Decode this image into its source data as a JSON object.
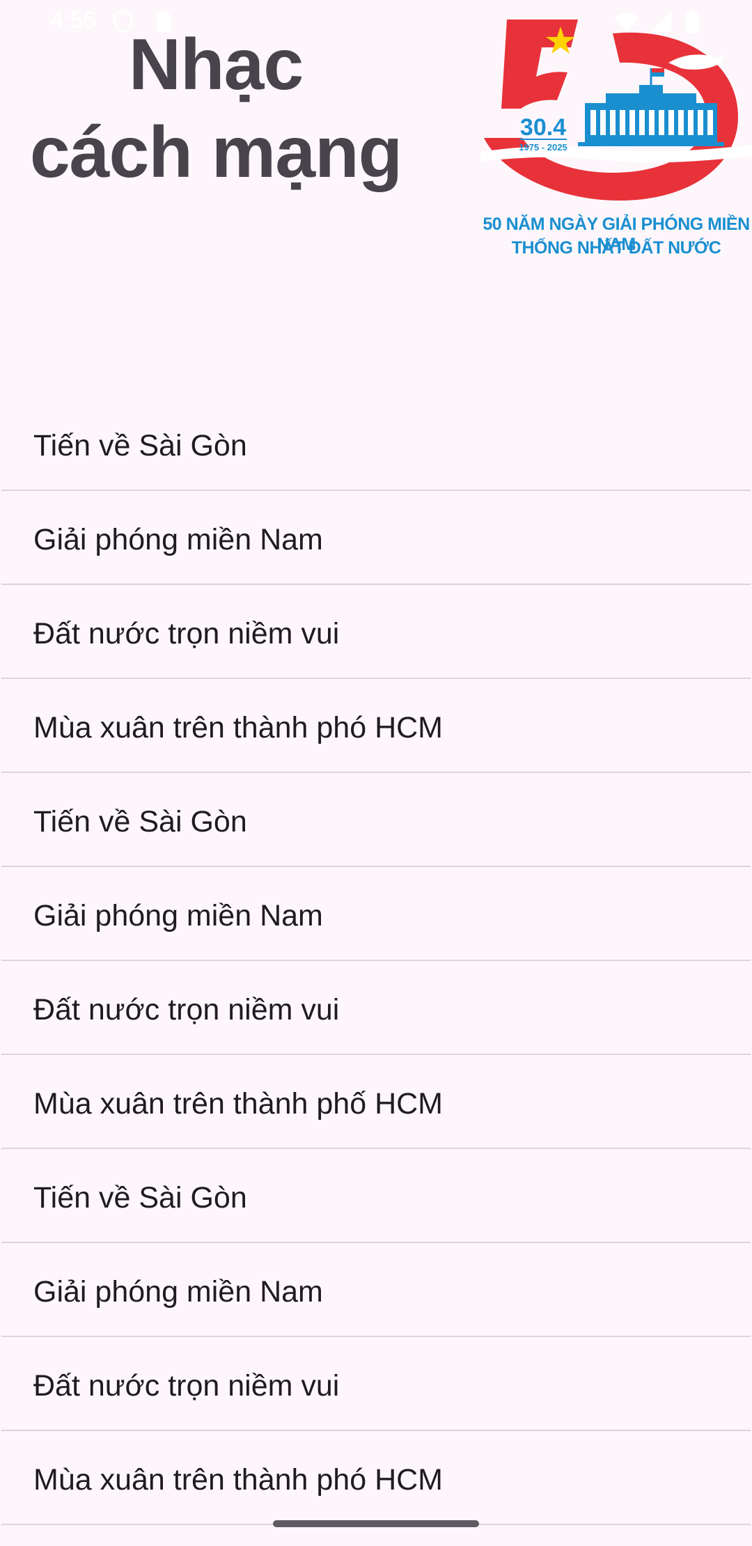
{
  "status_bar": {
    "time": "4:56"
  },
  "header": {
    "title_line1": "Nhạc",
    "title_line2": "cách mạng"
  },
  "logo": {
    "date": "30.4",
    "years": "1975 - 2025",
    "caption_line1": "50 NĂM NGÀY GIẢI PHÓNG MIỀN NAM",
    "caption_line2": "THỐNG NHẤT ĐẤT NƯỚC",
    "colors": {
      "red": "#e8323a",
      "blue": "#1a8fd0",
      "yellow": "#ffd200"
    }
  },
  "songs": [
    {
      "label": "Tiến về Sài Gòn"
    },
    {
      "label": "Giải phóng miền Nam"
    },
    {
      "label": "Đất nước trọn niềm vui"
    },
    {
      "label": "Mùa xuân trên thành phó HCM"
    },
    {
      "label": "Tiến về Sài Gòn"
    },
    {
      "label": "Giải phóng miền Nam"
    },
    {
      "label": "Đất nước trọn niềm vui"
    },
    {
      "label": "Mùa xuân trên thành phố HCM"
    },
    {
      "label": "Tiến về Sài Gòn"
    },
    {
      "label": "Giải phóng miền Nam"
    },
    {
      "label": "Đất nước trọn niềm vui"
    },
    {
      "label": "Mùa xuân trên thành phó HCM"
    }
  ]
}
